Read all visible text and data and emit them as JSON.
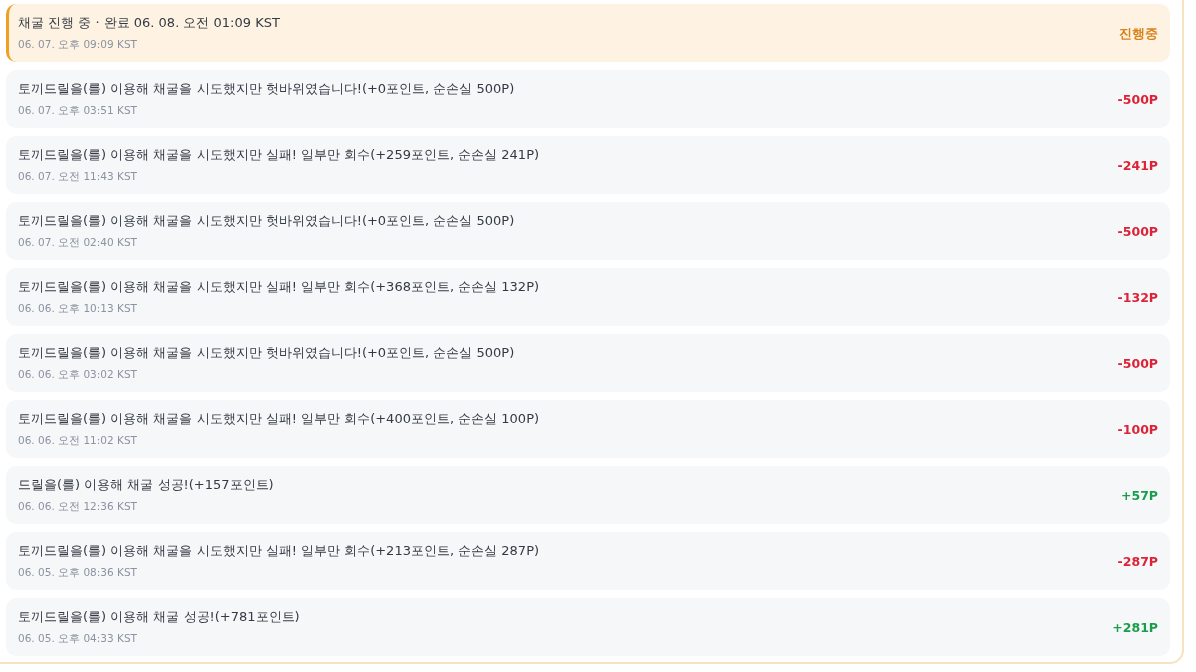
{
  "entries": [
    {
      "kind": "in_progress",
      "title": "채굴 진행 중 · 완료 06. 08. 오전 01:09 KST",
      "time": "06. 07. 오후 09:09 KST",
      "amount": "진행중"
    },
    {
      "kind": "loss",
      "title": "토끼드릴을(를) 이용해 채굴을 시도했지만 헛바위였습니다!(+0포인트, 순손실 500P)",
      "time": "06. 07. 오후 03:51 KST",
      "amount": "-500P"
    },
    {
      "kind": "loss",
      "title": "토끼드릴을(를) 이용해 채굴을 시도했지만 실패! 일부만 회수(+259포인트, 순손실 241P)",
      "time": "06. 07. 오전 11:43 KST",
      "amount": "-241P"
    },
    {
      "kind": "loss",
      "title": "토끼드릴을(를) 이용해 채굴을 시도했지만 헛바위였습니다!(+0포인트, 순손실 500P)",
      "time": "06. 07. 오전 02:40 KST",
      "amount": "-500P"
    },
    {
      "kind": "loss",
      "title": "토끼드릴을(를) 이용해 채굴을 시도했지만 실패! 일부만 회수(+368포인트, 순손실 132P)",
      "time": "06. 06. 오후 10:13 KST",
      "amount": "-132P"
    },
    {
      "kind": "loss",
      "title": "토끼드릴을(를) 이용해 채굴을 시도했지만 헛바위였습니다!(+0포인트, 순손실 500P)",
      "time": "06. 06. 오후 03:02 KST",
      "amount": "-500P"
    },
    {
      "kind": "loss",
      "title": "토끼드릴을(를) 이용해 채굴을 시도했지만 실패! 일부만 회수(+400포인트, 순손실 100P)",
      "time": "06. 06. 오전 11:02 KST",
      "amount": "-100P"
    },
    {
      "kind": "gain",
      "title": "드릴을(를) 이용해 채굴 성공!(+157포인트)",
      "time": "06. 06. 오전 12:36 KST",
      "amount": "+57P"
    },
    {
      "kind": "loss",
      "title": "토끼드릴을(를) 이용해 채굴을 시도했지만 실패! 일부만 회수(+213포인트, 순손실 287P)",
      "time": "06. 05. 오후 08:36 KST",
      "amount": "-287P"
    },
    {
      "kind": "gain",
      "title": "토끼드릴을(를) 이용해 채굴 성공!(+781포인트)",
      "time": "06. 05. 오후 04:33 KST",
      "amount": "+281P"
    }
  ]
}
